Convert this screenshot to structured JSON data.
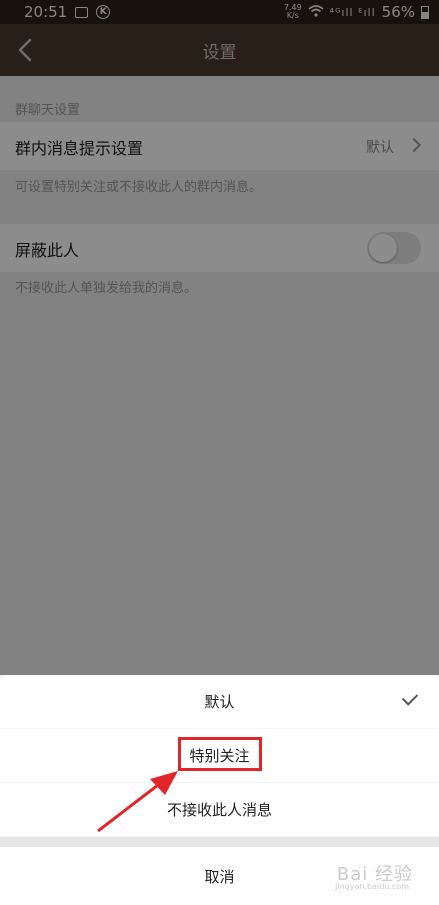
{
  "status_bar": {
    "time": "20:51",
    "net_speed_top": "7.49",
    "net_speed_bottom": "K/s",
    "signal": "⁴ᴳıll ᴱıll",
    "battery": "56%"
  },
  "nav": {
    "title": "设置"
  },
  "settings": {
    "section_label": "群聊天设置",
    "group_msg_title": "群内消息提示设置",
    "group_msg_value": "默认",
    "group_msg_desc": "可设置特别关注或不接收此人的群内消息。",
    "block_title": "屏蔽此人",
    "block_enabled": false,
    "block_desc": "不接收此人单独发给我的消息。"
  },
  "sheet": {
    "options": [
      {
        "label": "默认",
        "selected": true
      },
      {
        "label": "特别关注",
        "selected": false
      },
      {
        "label": "不接收此人消息",
        "selected": false
      }
    ],
    "cancel": "取消"
  },
  "watermark": {
    "main": "Bai 经验",
    "sub": "jingyan.baidu.com"
  },
  "colors": {
    "annotation": "#e1262a",
    "nav_bg": "#4a3a2c",
    "status_bg": "#2a211a"
  }
}
